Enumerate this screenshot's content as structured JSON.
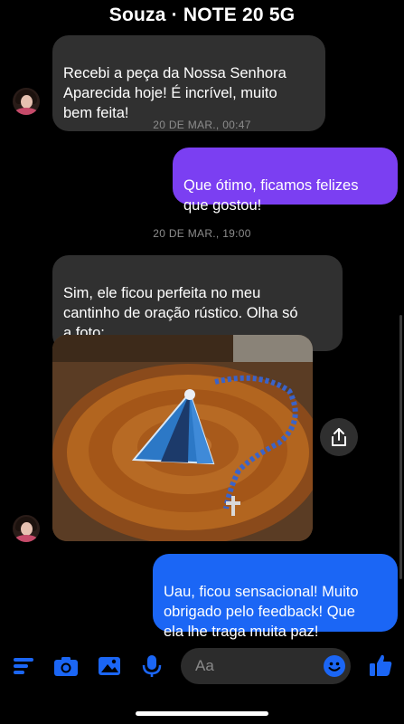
{
  "header": {
    "title": "Souza · NOTE 20 5G"
  },
  "messages": {
    "m1": "Recebi a peça da Nossa Senhora\nAparecida hoje! É incrível, muito\nbem feita!",
    "t1": "20 DE MAR., 00:47",
    "m2": "Que ótimo, ficamos felizes\nque gostou!",
    "t2": "20 DE MAR., 19:00",
    "m3": "Sim, ele ficou perfeita no meu\ncantinho de oração rústico. Olha só\na foto:",
    "m4": "Uau, ficou sensacional! Muito\nobrigado pelo feedback! Que\nela lhe traga muita paz!"
  },
  "composer": {
    "placeholder": "Aa"
  },
  "icons": {
    "menu": "menu-icon",
    "camera": "camera-icon",
    "gallery": "image-icon",
    "mic": "microphone-icon",
    "emoji": "emoji-icon",
    "like": "thumbs-up-icon",
    "share": "share-icon"
  },
  "colors": {
    "accent": "#1b66f5",
    "outgoing_purple": "#7b3ff2",
    "incoming": "#303030",
    "background": "#000000"
  }
}
